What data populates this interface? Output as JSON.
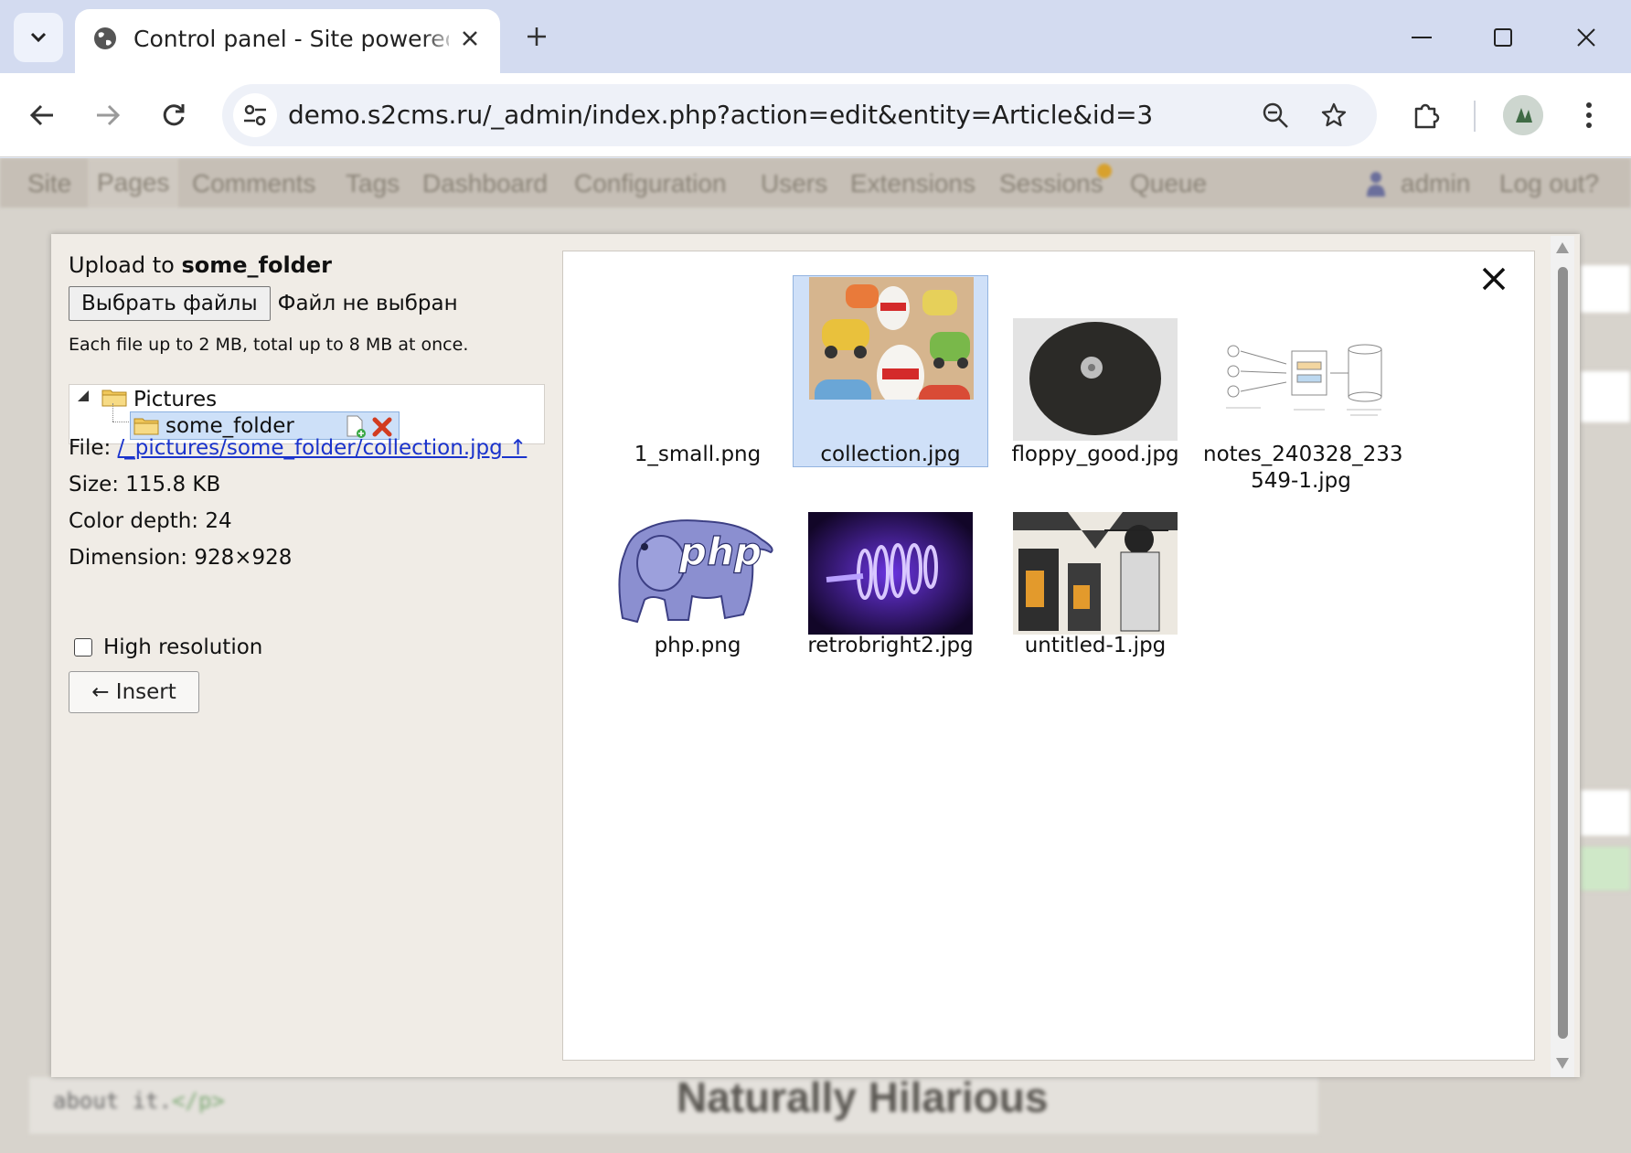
{
  "browser": {
    "tab_title": "Control panel - Site powered by",
    "url": "demo.s2cms.ru/_admin/index.php?action=edit&entity=Article&id=3"
  },
  "admin_nav": {
    "items": [
      "Site",
      "Pages",
      "Comments",
      "Tags",
      "Dashboard",
      "Configuration",
      "Users",
      "Extensions",
      "Sessions",
      "Queue"
    ],
    "user": "admin",
    "logout": "Log out?"
  },
  "backdrop": {
    "code_snippet": "about it.",
    "code_tag": "</p>",
    "heading_fragment": "Naturally Hilarious"
  },
  "upload": {
    "title_prefix": "Upload to ",
    "folder": "some_folder",
    "choose_button": "Выбрать файлы",
    "choose_status": "Файл не выбран",
    "limit_note": "Each file up to 2 MB, total up to 8 MB at once."
  },
  "tree": {
    "root": "Pictures",
    "selected": "some_folder"
  },
  "file_info": {
    "file_label": "File: ",
    "file_link": "/_pictures/some_folder/collection.jpg ↑",
    "size": "Size: 115.8 KB",
    "color_depth": "Color depth: 24",
    "dimension": "Dimension: 928×928",
    "high_res_label": "High resolution",
    "insert_button": "← Insert"
  },
  "files": [
    {
      "name": "1_small.png",
      "selected": false,
      "thumb": "blank"
    },
    {
      "name": "collection.jpg",
      "selected": true,
      "thumb": "toy-cars-eggs"
    },
    {
      "name": "floppy_good.jpg",
      "selected": false,
      "thumb": "floppy-disk"
    },
    {
      "name": "notes_240328_233\n549-1.jpg",
      "selected": false,
      "thumb": "sketch-diagram"
    },
    {
      "name": "php.png",
      "selected": false,
      "thumb": "php-elephant"
    },
    {
      "name": "retrobright2.jpg",
      "selected": false,
      "thumb": "purple-glow"
    },
    {
      "name": "untitled-1.jpg",
      "selected": false,
      "thumb": "illustration"
    }
  ],
  "colors": {
    "selection_bg": "#cfe0f8",
    "link": "#1a33cc",
    "dialog_bg": "#f0ece6"
  }
}
